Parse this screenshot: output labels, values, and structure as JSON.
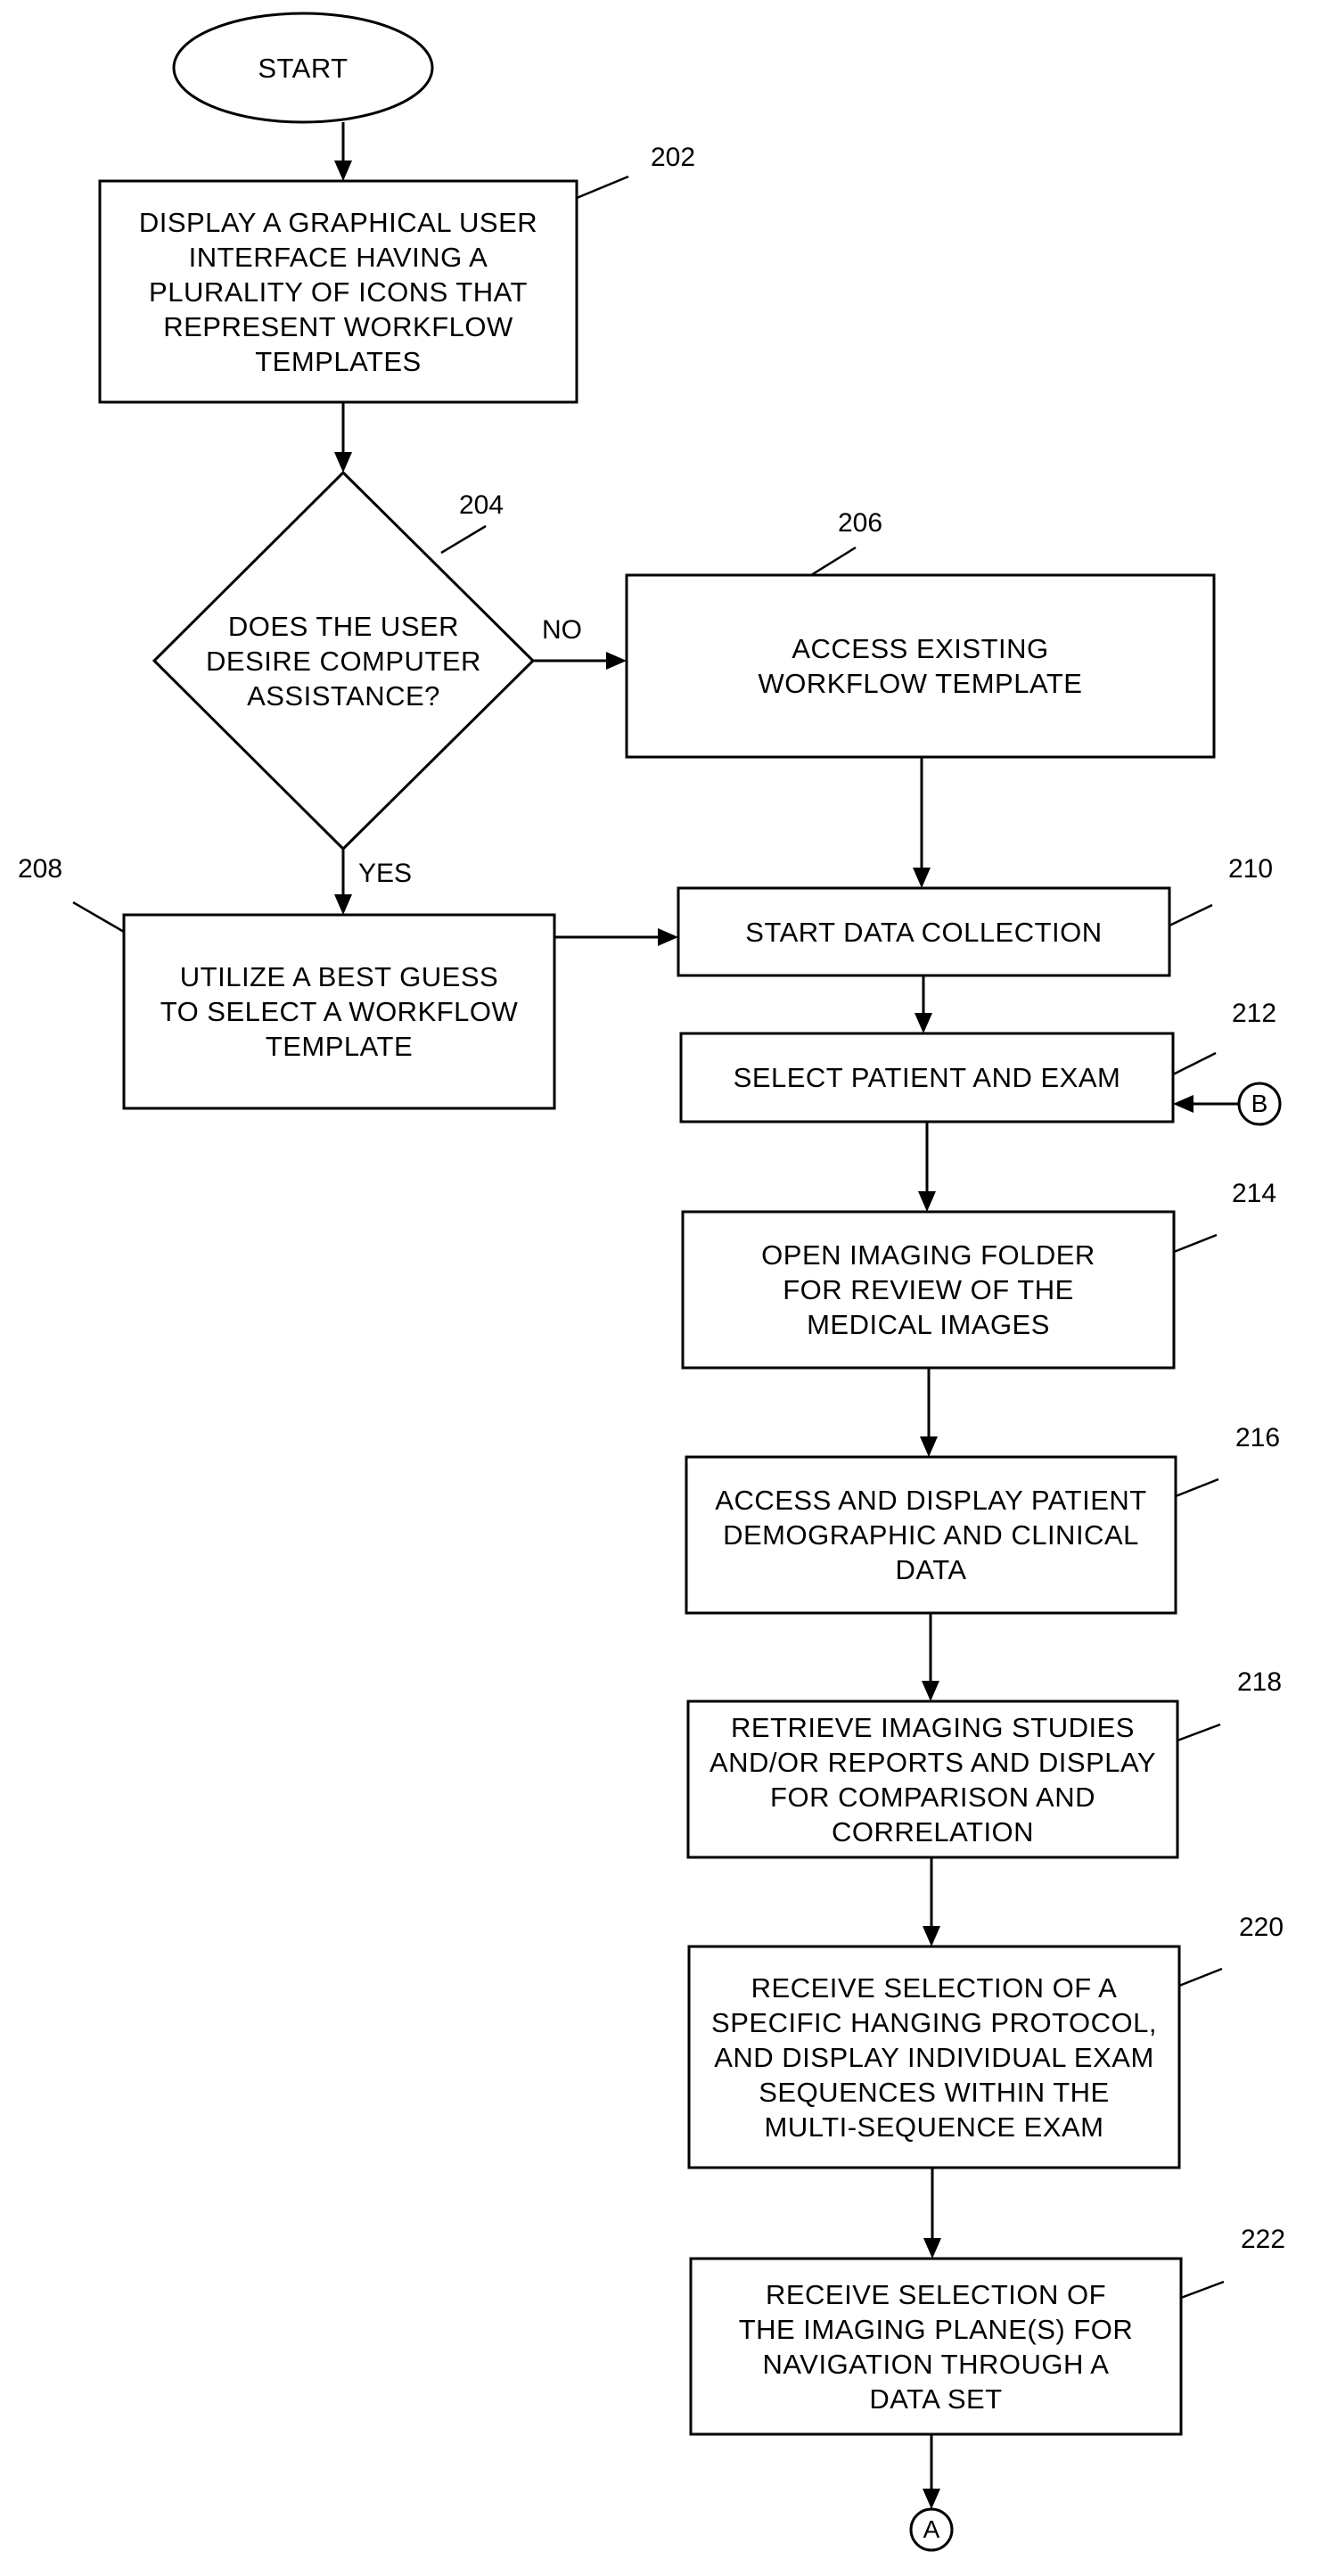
{
  "diagram": {
    "type": "flowchart",
    "start": {
      "label": "START"
    },
    "steps": [
      {
        "id": "202",
        "ref": "202",
        "label": "DISPLAY A GRAPHICAL USER\nINTERFACE HAVING A\nPLURALITY OF ICONS THAT\nREPRESENT WORKFLOW\nTEMPLATES"
      },
      {
        "id": "204",
        "ref": "204",
        "label": "DOES THE USER\nDESIRE COMPUTER\nASSISTANCE?",
        "kind": "decision"
      },
      {
        "id": "206",
        "ref": "206",
        "label": "ACCESS EXISTING\nWORKFLOW TEMPLATE"
      },
      {
        "id": "208",
        "ref": "208",
        "label": "UTILIZE A BEST GUESS\nTO SELECT A WORKFLOW\nTEMPLATE"
      },
      {
        "id": "210",
        "ref": "210",
        "label": "START DATA COLLECTION"
      },
      {
        "id": "212",
        "ref": "212",
        "label": "SELECT PATIENT AND EXAM"
      },
      {
        "id": "214",
        "ref": "214",
        "label": "OPEN IMAGING FOLDER\nFOR REVIEW OF THE\nMEDICAL IMAGES"
      },
      {
        "id": "216",
        "ref": "216",
        "label": "ACCESS AND DISPLAY PATIENT\nDEMOGRAPHIC AND CLINICAL\nDATA"
      },
      {
        "id": "218",
        "ref": "218",
        "label": "RETRIEVE IMAGING STUDIES\nAND/OR REPORTS AND DISPLAY\nFOR COMPARISON AND\nCORRELATION"
      },
      {
        "id": "220",
        "ref": "220",
        "label": "RECEIVE SELECTION OF A\nSPECIFIC HANGING PROTOCOL,\nAND DISPLAY INDIVIDUAL EXAM\nSEQUENCES WITHIN THE\nMULTI-SEQUENCE EXAM"
      },
      {
        "id": "222",
        "ref": "222",
        "label": "RECEIVE SELECTION OF\nTHE IMAGING PLANE(S) FOR\nNAVIGATION THROUGH A\nDATA SET"
      }
    ],
    "branches": {
      "no": "NO",
      "yes": "YES"
    },
    "connectors": {
      "in": "B",
      "out": "A"
    }
  }
}
